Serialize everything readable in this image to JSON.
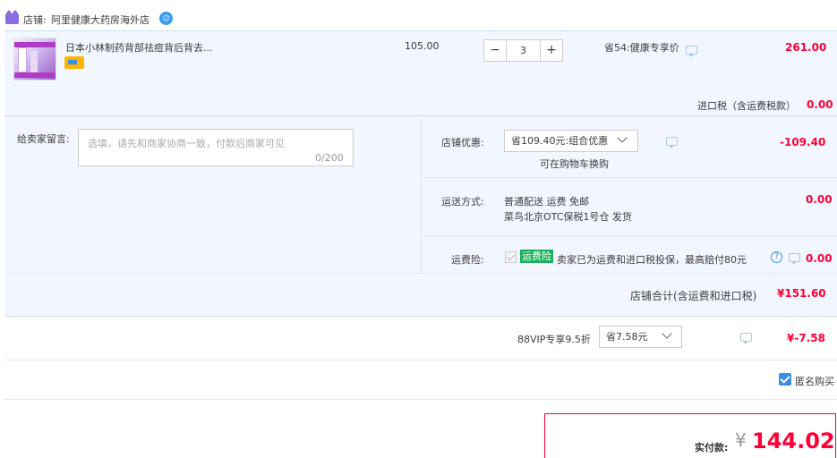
{
  "shop": {
    "label": "店铺:",
    "name": "阿里健康大药房海外店",
    "icon": "wangwang-chat-icon"
  },
  "item": {
    "title": "日本小林制药背部祛痘背后背去...",
    "unit_price": "105.00",
    "quantity": "3",
    "minus_label": "−",
    "plus_label": "+",
    "promo": "省54:健康专享价",
    "total": "261.00",
    "tax_label": "进口税（含运费税款）",
    "tax_value": "0.00"
  },
  "message": {
    "label": "给卖家留言:",
    "placeholder": "选填，请先和商家协商一致，付款后商家可见",
    "count": "0/200"
  },
  "coupon": {
    "label": "店铺优惠:",
    "selected": "省109.40元:组合优惠",
    "sub": "可在购物车换购",
    "value": "-109.40"
  },
  "shipping": {
    "label": "运送方式:",
    "line1": "普通配送 运费 免邮",
    "line2": "菜鸟北京OTC保税1号仓   发货",
    "value": "0.00"
  },
  "insurance": {
    "label": "运费险:",
    "badge": "运费险",
    "text": "卖家已为运费和进口税投保，最高赔付80元",
    "help": "?",
    "value": "0.00"
  },
  "shop_total": {
    "label": "店铺合计(含运费和进口税)",
    "value": "¥151.60"
  },
  "vip": {
    "label": "88VIP专享9.5折",
    "selected": "省7.58元",
    "value": "¥-7.58"
  },
  "anonymous": {
    "label": "匿名购买",
    "checked": true
  },
  "payment": {
    "label": "实付款:",
    "currency": "¥",
    "amount": "144.02"
  },
  "colors": {
    "accent_red": "#ff0036",
    "accent_blue": "#3a8ee6",
    "panel_bg": "#f2f7ff",
    "insurance_green": "#1aaf5d"
  }
}
